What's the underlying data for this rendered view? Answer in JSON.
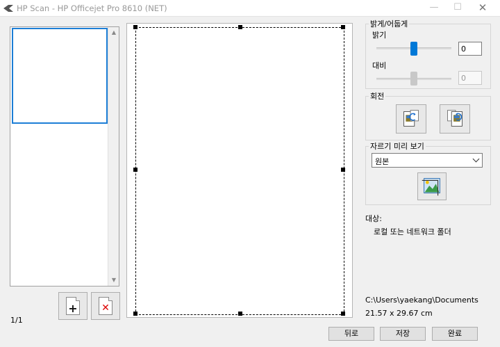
{
  "window": {
    "title": "HP Scan - HP Officejet Pro 8610 (NET)",
    "minimize_icon": "minimize-icon",
    "maximize_icon": "maximize-icon",
    "close_icon": "close-icon"
  },
  "thumbnails": {
    "page_count": "1/1",
    "add_page_icon": "add-page-icon",
    "delete_page_icon": "delete-page-icon"
  },
  "adjust": {
    "group_title": "밝게/어둡게",
    "brightness_label": "밝기",
    "brightness_value": "0",
    "contrast_label": "대비",
    "contrast_value": "0"
  },
  "rotate": {
    "group_title": "회전",
    "rotate_left_icon": "rotate-left-icon",
    "rotate_right_icon": "rotate-right-icon"
  },
  "crop": {
    "group_title": "자르기 미리 보기",
    "selected_option": "원본",
    "crop_icon": "crop-image-icon"
  },
  "destination": {
    "label": "대상:",
    "value": "로컬 또는 네트워크 폴더",
    "path": "C:\\Users\\yaekang\\Documents",
    "size": "21.57 x 29.67 cm"
  },
  "buttons": {
    "back": "뒤로",
    "save": "저장",
    "done": "완료"
  },
  "colors": {
    "accent": "#0078d7",
    "selection": "#1c7ed6"
  }
}
